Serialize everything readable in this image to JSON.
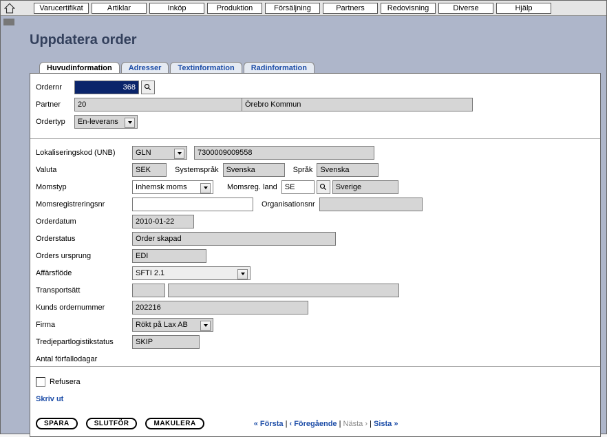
{
  "top_menu": [
    "Varucertifikat",
    "Artiklar",
    "Inköp",
    "Produktion",
    "Försäljning",
    "Partners",
    "Redovisning",
    "Diverse",
    "Hjälp"
  ],
  "page_title": "Uppdatera order",
  "tabs": {
    "huvudinfo": "Huvudinformation",
    "adresser": "Adresser",
    "textinfo": "Textinformation",
    "radinfo": "Radinformation"
  },
  "fields": {
    "ordernr_label": "Ordernr",
    "ordernr_value": "368",
    "partner_label": "Partner",
    "partner_code": "20",
    "partner_name": "Örebro Kommun",
    "ordertyp_label": "Ordertyp",
    "ordertyp_value": "En-leverans",
    "lokaliseringskod_label": "Lokaliseringskod (UNB)",
    "lokaliseringskod_type": "GLN",
    "lokaliseringskod_value": "7300009009558",
    "valuta_label": "Valuta",
    "valuta_value": "SEK",
    "systemsprak_label": "Systemspråk",
    "systemsprak_value": "Svenska",
    "sprak_label": "Språk",
    "sprak_value": "Svenska",
    "momstyp_label": "Momstyp",
    "momstyp_value": "Inhemsk moms",
    "momsreg_land_label": "Momsreg. land",
    "momsreg_land_code": "SE",
    "momsreg_land_name": "Sverige",
    "momsregnr_label": "Momsregistreringsnr",
    "momsregnr_value": "",
    "orgnr_label": "Organisationsnr",
    "orgnr_value": "",
    "orderdatum_label": "Orderdatum",
    "orderdatum_value": "2010-01-22",
    "orderstatus_label": "Orderstatus",
    "orderstatus_value": "Order skapad",
    "orders_ursprung_label": "Orders ursprung",
    "orders_ursprung_value": "EDI",
    "affarsflode_label": "Affärsflöde",
    "affarsflode_value": "SFTI 2.1",
    "transportsatt_label": "Transportsätt",
    "transportsatt_code": "",
    "transportsatt_name": "",
    "kunds_ordernr_label": "Kunds ordernummer",
    "kunds_ordernr_value": "202216",
    "firma_label": "Firma",
    "firma_value": "Rökt på Lax AB",
    "tredjeparts_label": "Tredjepartlogistikstatus",
    "tredjeparts_value": "SKIP",
    "forfallodagar_label": "Antal förfallodagar"
  },
  "footer": {
    "refusera": "Refusera",
    "skriv_ut": "Skriv ut",
    "spara": "SPARA",
    "slutfor": "SLUTFÖR",
    "makulera": "MAKULERA",
    "nav_forsta": "« Första",
    "nav_foregaende": "‹ Föregående",
    "nav_nasta": "Nästa ›",
    "nav_sista": "Sista »",
    "sep": " | "
  }
}
